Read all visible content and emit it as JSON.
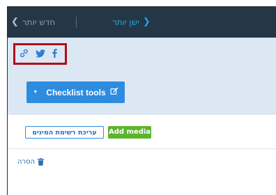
{
  "nav": {
    "prev_label": "חדש יותר",
    "next_label": "ישן יותר",
    "prev_icon": "chevron-left-icon",
    "next_icon": "chevron-right-icon"
  },
  "share": {
    "icons": [
      "link-icon",
      "twitter-icon",
      "facebook-icon"
    ]
  },
  "checklist": {
    "label": "Checklist tools",
    "icon": "edit-icon"
  },
  "actions": {
    "edit_types_label": "עריכת רשימת המינים",
    "add_media_label": "Add media"
  },
  "remove": {
    "label": "הסרה",
    "icon": "trash-icon"
  },
  "colors": {
    "topbar": "#253746",
    "band": "#dce7f4",
    "primary": "#2d8ce0",
    "success": "#5ab52d",
    "highlight": "#b00d18",
    "link": "#21a5e6"
  }
}
